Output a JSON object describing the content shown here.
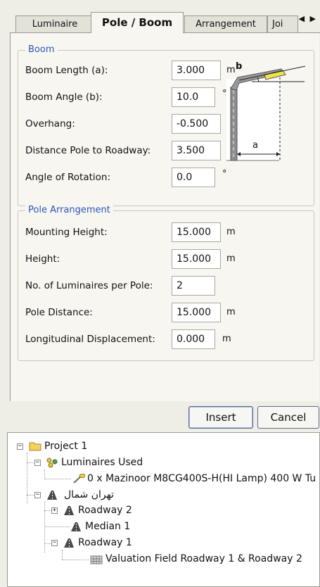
{
  "tabs": [
    {
      "label": "Luminaire"
    },
    {
      "label": "Pole / Boom"
    },
    {
      "label": "Arrangement"
    },
    {
      "label": "Joi"
    }
  ],
  "tab_arrows": "◀ ▶",
  "boom": {
    "title": "Boom",
    "rows": [
      {
        "label": "Boom Length (a):",
        "value": "3.000",
        "unit": "m"
      },
      {
        "label": "Boom Angle (b):",
        "value": "10.0",
        "unit": "°"
      },
      {
        "label": "Overhang:",
        "value": "-0.500",
        "unit": "m"
      },
      {
        "label": "Distance Pole to Roadway:",
        "value": "3.500",
        "unit": "m"
      },
      {
        "label": "Angle of Rotation:",
        "value": "0.0",
        "unit": "°"
      }
    ],
    "diagram": {
      "label_a": "a",
      "label_b": "b"
    }
  },
  "pole": {
    "title": "Pole Arrangement",
    "rows": [
      {
        "label": "Mounting Height:",
        "value": "15.000",
        "unit": "m"
      },
      {
        "label": "Height:",
        "value": "15.000",
        "unit": "m"
      },
      {
        "label": "No. of Luminaires per Pole:",
        "value": "2",
        "unit": ""
      },
      {
        "label": "Pole Distance:",
        "value": "15.000",
        "unit": "m"
      },
      {
        "label": "Longitudinal Displacement:",
        "value": "0.000",
        "unit": "m"
      }
    ]
  },
  "buttons": {
    "insert": "Insert",
    "cancel": "Cancel"
  },
  "tree": {
    "project": "Project 1",
    "luminaires_used": "Luminaires Used",
    "luminaire_item": "0 x Mazinoor M8CG400S-H(HI Lamp) 400 W Tu",
    "street": "تهران شمال",
    "roadway2": "Roadway 2",
    "median1": "Median 1",
    "roadway1": "Roadway 1",
    "valuation": "Valuation Field Roadway 1 & Roadway 2"
  }
}
